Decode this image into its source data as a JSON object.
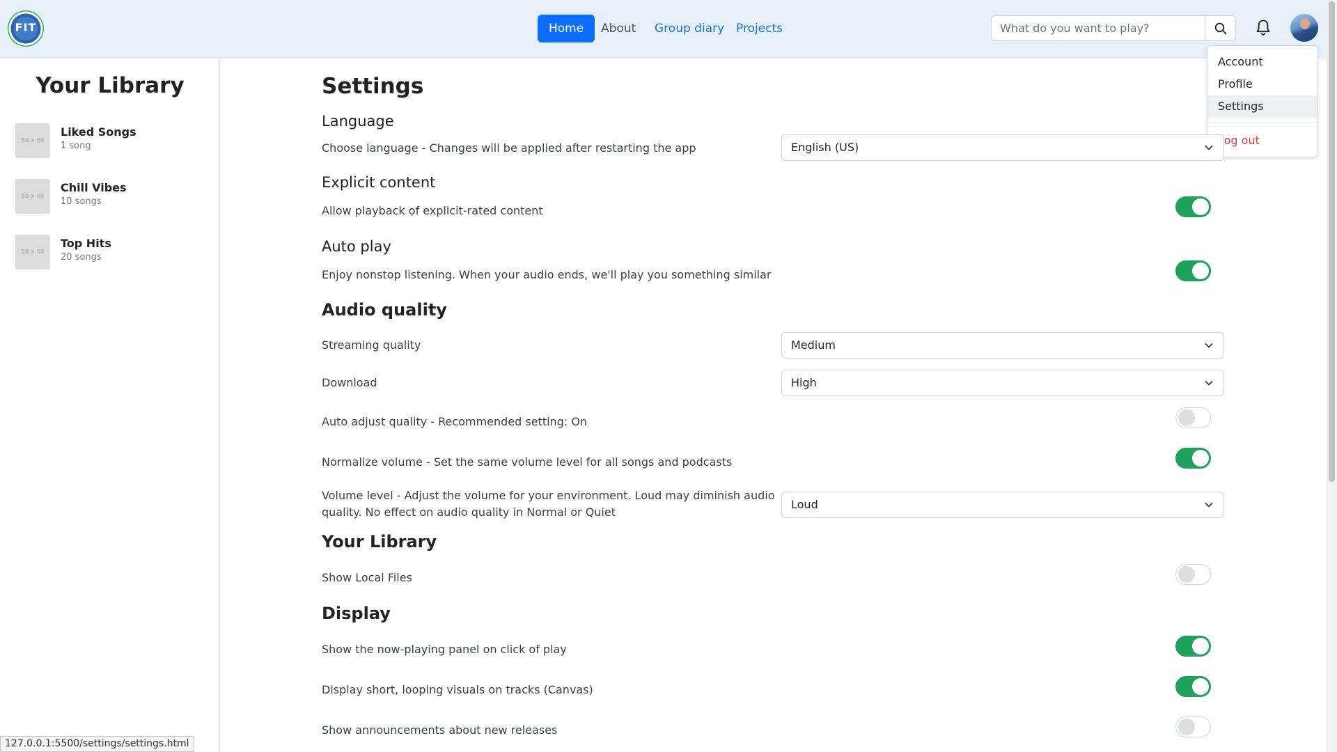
{
  "nav": {
    "logo_text": "FIT",
    "links": [
      {
        "label": "Home"
      },
      {
        "label": "About"
      },
      {
        "label": "Group diary"
      },
      {
        "label": "Projects"
      }
    ],
    "search_placeholder": "What do you want to play?"
  },
  "user_menu": {
    "items": [
      {
        "label": "Account"
      },
      {
        "label": "Profile"
      },
      {
        "label": "Settings"
      }
    ],
    "logout": "Log out"
  },
  "library": {
    "title": "Your Library",
    "thumb_placeholder": "50 × 50",
    "items": [
      {
        "name": "Liked Songs",
        "count": "1 song"
      },
      {
        "name": "Chill Vibes",
        "count": "10 songs"
      },
      {
        "name": "Top Hits",
        "count": "20 songs"
      }
    ]
  },
  "settings": {
    "title": "Settings",
    "language": {
      "heading": "Language",
      "label": "Choose language - Changes will be applied after restarting the app",
      "value": "English (US)"
    },
    "explicit": {
      "heading": "Explicit content",
      "label": "Allow playback of explicit-rated content",
      "on": true
    },
    "autoplay": {
      "heading": "Auto play",
      "label": "Enjoy nonstop listening. When your audio ends, we'll play you something similar",
      "on": true
    },
    "audio_quality": {
      "heading": "Audio quality",
      "streaming_label": "Streaming quality",
      "streaming_value": "Medium",
      "download_label": "Download",
      "download_value": "High",
      "auto_adjust_label": "Auto adjust quality - Recommended setting: On",
      "auto_adjust_on": false,
      "normalize_label": "Normalize volume - Set the same volume level for all songs and podcasts",
      "normalize_on": true,
      "volume_label_line1": "Volume level - Adjust the volume for your environment. Loud may diminish audio",
      "volume_label_line2": "quality. No effect on audio quality in Normal or Quiet",
      "volume_value": "Loud"
    },
    "your_library": {
      "heading": "Your Library",
      "local_files_label": "Show Local Files",
      "local_files_on": false
    },
    "display": {
      "heading": "Display",
      "now_playing_label": "Show the now-playing panel on click of play",
      "now_playing_on": true,
      "canvas_label": "Display short, looping visuals on tracks (Canvas)",
      "canvas_on": true,
      "announcements_label": "Show announcements about new releases",
      "announcements_on": false
    }
  },
  "status_url": "127.0.0.1:5500/settings/settings.html"
}
